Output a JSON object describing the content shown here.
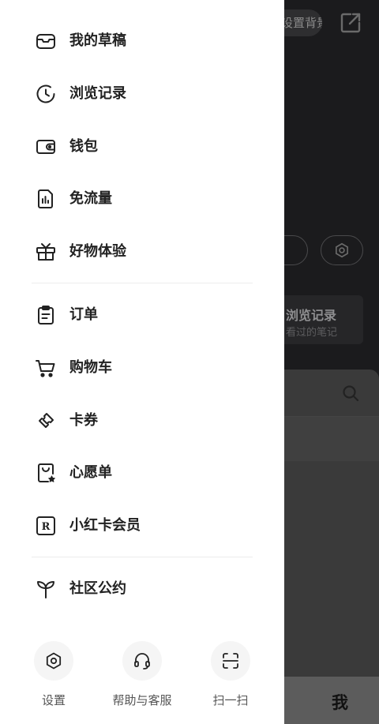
{
  "background": {
    "pill_text": "设置背景",
    "card_title": "浏览记录",
    "card_sub": "看过的笔记",
    "tab_me": "我"
  },
  "drawer": {
    "group1": [
      {
        "label": "我的草稿",
        "icon": "draft-tray-icon"
      },
      {
        "label": "浏览记录",
        "icon": "clock-history-icon"
      },
      {
        "label": "钱包",
        "icon": "wallet-icon"
      },
      {
        "label": "免流量",
        "icon": "data-sim-icon"
      },
      {
        "label": "好物体验",
        "icon": "gift-box-icon"
      }
    ],
    "group2": [
      {
        "label": "订单",
        "icon": "clipboard-order-icon"
      },
      {
        "label": "购物车",
        "icon": "shopping-cart-icon"
      },
      {
        "label": "卡券",
        "icon": "ticket-coupon-icon"
      },
      {
        "label": "心愿单",
        "icon": "wishlist-bag-icon"
      },
      {
        "label": "小红卡会员",
        "icon": "r-card-member-icon"
      }
    ],
    "group3": [
      {
        "label": "社区公约",
        "icon": "sprout-icon"
      }
    ],
    "bottom": [
      {
        "label": "设置",
        "icon": "settings-gear-icon"
      },
      {
        "label": "帮助与客服",
        "icon": "headset-support-icon"
      },
      {
        "label": "扫一扫",
        "icon": "scan-icon"
      }
    ]
  }
}
